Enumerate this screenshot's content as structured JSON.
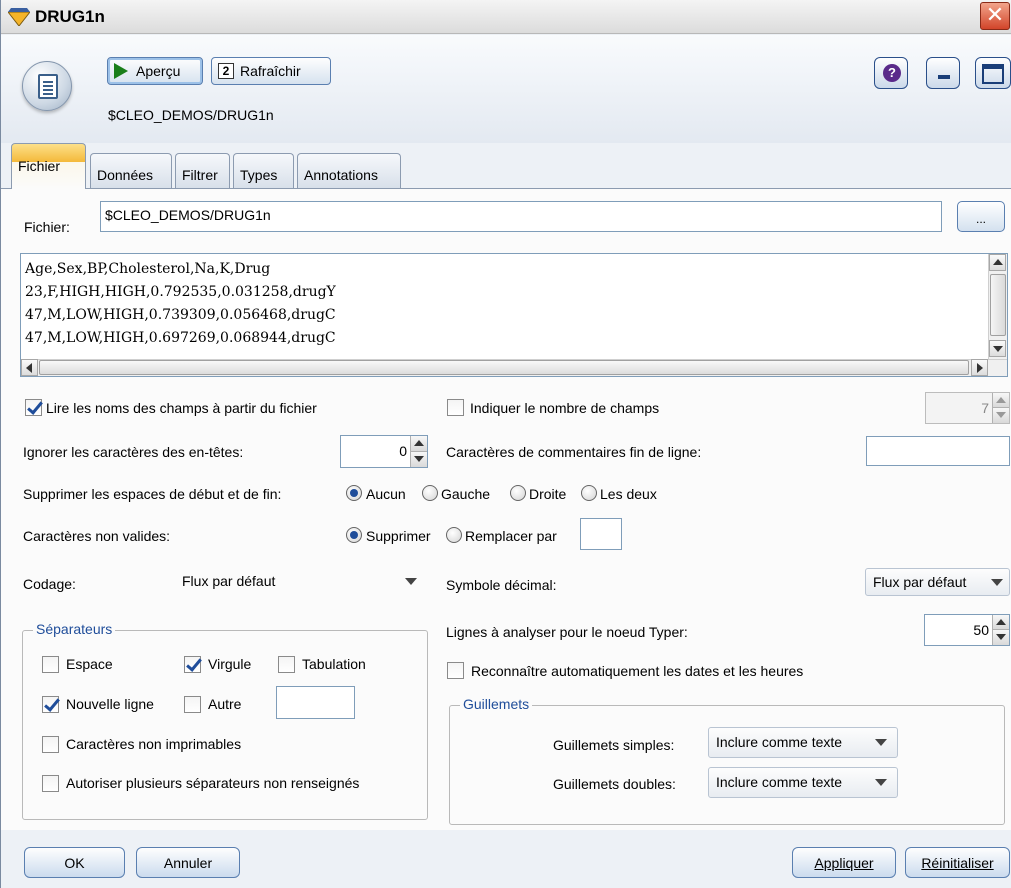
{
  "window": {
    "title": "DRUG1n"
  },
  "toolbar": {
    "preview_label": "Aperçu",
    "refresh_label": "Rafraîchir",
    "path": "$CLEO_DEMOS/DRUG1n"
  },
  "tabs": [
    {
      "label": "Fichier",
      "active": true
    },
    {
      "label": "Données",
      "active": false
    },
    {
      "label": "Filtrer",
      "active": false
    },
    {
      "label": "Types",
      "active": false
    },
    {
      "label": "Annotations",
      "active": false
    }
  ],
  "file": {
    "label": "Fichier:",
    "value": "$CLEO_DEMOS/DRUG1n",
    "browse_label": "..."
  },
  "preview_lines": [
    "Age,Sex,BP,Cholesterol,Na,K,Drug",
    "23,F,HIGH,HIGH,0.792535,0.031258,drugY",
    "47,M,LOW,HIGH,0.739309,0.056468,drugC",
    "47,M,LOW,HIGH,0.697269,0.068944,drugC"
  ],
  "options": {
    "read_names_label": "Lire les noms des champs à partir du fichier",
    "read_names_checked": true,
    "specify_count_label": "Indiquer le nombre de champs",
    "specify_count_checked": false,
    "field_count": "7",
    "skip_header_label": "Ignorer les caractères des en-têtes:",
    "skip_header_value": "0",
    "eol_comment_label": "Caractères de commentaires fin de ligne:",
    "eol_comment_value": "",
    "strip_spaces_label": "Supprimer les espaces de début et de fin:",
    "strip_spaces_options": [
      "Aucun",
      "Gauche",
      "Droite",
      "Les deux"
    ],
    "strip_spaces_selected": "Aucun",
    "invalid_chars_label": "Caractères non valides:",
    "invalid_chars_options": [
      "Supprimer",
      "Remplacer par"
    ],
    "invalid_chars_selected": "Supprimer",
    "replace_value": "",
    "encoding_label": "Codage:",
    "encoding_value": "Flux par défaut",
    "decimal_label": "Symbole décimal:",
    "decimal_value": "Flux par défaut",
    "scan_lines_label": "Lignes à analyser pour le noeud Typer:",
    "scan_lines_value": "50",
    "auto_dates_label": "Reconnaître automatiquement les dates et les heures",
    "auto_dates_checked": false
  },
  "separators": {
    "legend": "Séparateurs",
    "space_label": "Espace",
    "space_checked": false,
    "comma_label": "Virgule",
    "comma_checked": true,
    "tab_label": "Tabulation",
    "tab_checked": false,
    "newline_label": "Nouvelle ligne",
    "newline_checked": true,
    "other_label": "Autre",
    "other_checked": false,
    "other_value": "",
    "nonprint_label": "Caractères non imprimables",
    "nonprint_checked": false,
    "multi_blank_label": "Autoriser plusieurs séparateurs non renseignés",
    "multi_blank_checked": false
  },
  "quotes": {
    "legend": "Guillemets",
    "single_label": "Guillemets simples:",
    "single_value": "Inclure comme texte",
    "double_label": "Guillemets doubles:",
    "double_value": "Inclure comme texte"
  },
  "buttons": {
    "ok": "OK",
    "cancel": "Annuler",
    "apply": "Appliquer",
    "reset": "Réinitialiser"
  },
  "colors": {
    "accent": "#1f4d9a",
    "active_tab": "#f4b93a",
    "close_button": "#d2452a"
  }
}
